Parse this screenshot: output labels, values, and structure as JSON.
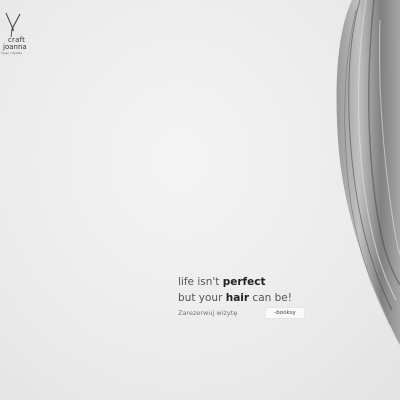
{
  "brand": {
    "line1": "craft",
    "line2": "joanna",
    "tagline": "fryzjer / stylistka"
  },
  "hero": {
    "line1_pre": "life isn't ",
    "line1_bold": "perfect",
    "line2_pre": "but your ",
    "line2_bold": "hair",
    "line2_post": " can be!"
  },
  "cta": {
    "reserve_label": "Zarezerwuj wizytę",
    "booksy_label": "-booksy"
  },
  "colors": {
    "background": "#ececec",
    "text_dark": "#222222",
    "text_muted": "#777777"
  },
  "icons": [
    "scissors-logo-icon"
  ]
}
